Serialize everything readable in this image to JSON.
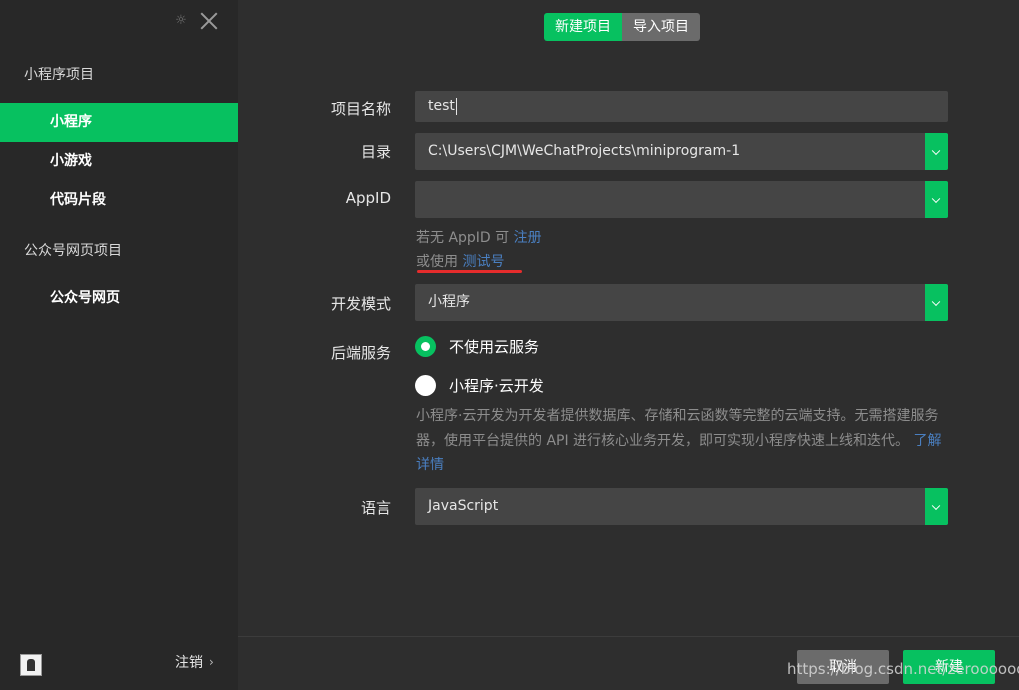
{
  "sidebar": {
    "mini_group_title": "小程序项目",
    "items": [
      {
        "label": "小程序",
        "active": true
      },
      {
        "label": "小游戏",
        "active": false
      },
      {
        "label": "代码片段",
        "active": false
      }
    ],
    "official_group_title": "公众号网页项目",
    "official_item": {
      "label": "公众号网页"
    },
    "logout_label": "注销",
    "logout_chevron": "›"
  },
  "tabs": [
    {
      "label": "新建项目",
      "active": true
    },
    {
      "label": "导入项目",
      "active": false
    }
  ],
  "form": {
    "project_name": {
      "label": "项目名称",
      "value": "test"
    },
    "directory": {
      "label": "目录",
      "value": "C:\\Users\\CJM\\WeChatProjects\\miniprogram-1"
    },
    "appid": {
      "label": "AppID",
      "value": "",
      "hint_prefix": "若无 AppID 可 ",
      "register_link": "注册",
      "alt_prefix": "或使用 ",
      "test_link": "测试号"
    },
    "dev_mode": {
      "label": "开发模式",
      "value": "小程序"
    },
    "backend": {
      "label": "后端服务",
      "options": [
        {
          "label": "不使用云服务",
          "checked": true
        },
        {
          "label": "小程序·云开发",
          "checked": false
        }
      ],
      "description": "小程序·云开发为开发者提供数据库、存储和云函数等完整的云端支持。无需搭建服务器，使用平台提供的 API 进行核心业务开发，即可实现小程序快速上线和迭代。",
      "learn_more": "了解详情"
    },
    "language": {
      "label": "语言",
      "value": "JavaScript"
    }
  },
  "buttons": {
    "cancel": "取消",
    "create": "新建"
  },
  "watermark": "https://blog.csdn.net/zerooooooo",
  "colors": {
    "accent": "#07c160",
    "link": "#4a7fc0",
    "annotation": "#e62c2c"
  }
}
